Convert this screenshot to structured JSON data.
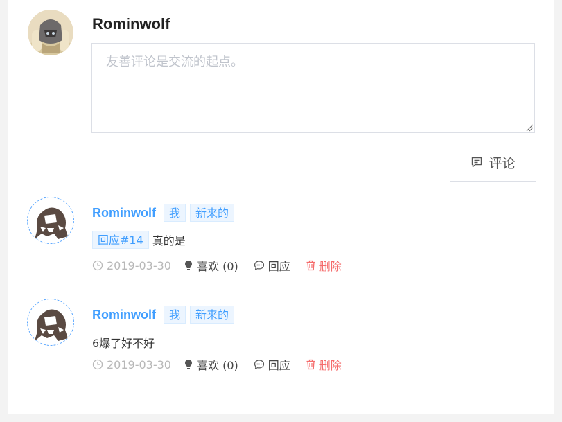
{
  "composer": {
    "username": "Rominwolf",
    "placeholder": "友善评论是交流的起点。",
    "submit_label": "评论"
  },
  "comments": [
    {
      "author": "Rominwolf",
      "tags": [
        "我",
        "新来的"
      ],
      "reply_tag": "回应#14",
      "text": "真的是",
      "date": "2019-03-30",
      "like_label": "喜欢 (0)",
      "reply_label": "回应",
      "delete_label": "删除"
    },
    {
      "author": "Rominwolf",
      "tags": [
        "我",
        "新来的"
      ],
      "text": "6爆了好不好",
      "date": "2019-03-30",
      "like_label": "喜欢 (0)",
      "reply_label": "回应",
      "delete_label": "删除"
    }
  ],
  "colors": {
    "accent": "#409eff",
    "tag_bg": "#ecf5ff",
    "danger": "#f56c6c",
    "muted": "#b8b8b8",
    "page_bg": "#f3f3f3"
  },
  "icons": {
    "submit": "comment-icon",
    "date": "clock-icon",
    "like": "bulb-icon",
    "reply": "chat-bubble-icon",
    "delete": "trash-icon"
  }
}
